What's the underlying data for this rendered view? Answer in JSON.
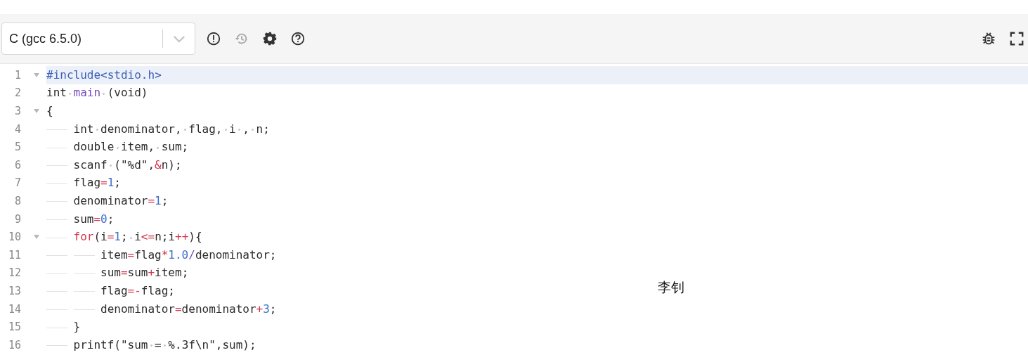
{
  "toolbar": {
    "language_select": {
      "value": "C (gcc 6.5.0)"
    },
    "left_buttons": [
      {
        "kind": "info",
        "disabled": false
      },
      {
        "kind": "history",
        "disabled": true
      },
      {
        "kind": "settings",
        "disabled": false
      },
      {
        "kind": "help",
        "disabled": false
      }
    ],
    "right_buttons": [
      {
        "kind": "debug",
        "disabled": false
      },
      {
        "kind": "fullscreen",
        "disabled": false
      }
    ]
  },
  "editor": {
    "lines": [
      {
        "number": "1",
        "foldable": true,
        "active": true,
        "tokens": [
          {
            "text": "#include<stdio.h>",
            "kind": "meta"
          }
        ]
      },
      {
        "number": "2",
        "foldable": false,
        "active": false,
        "tokens": [
          {
            "text": "int ",
            "kind": "plain"
          },
          {
            "text": "main",
            "kind": "function"
          },
          {
            "text": " (void)",
            "kind": "plain"
          }
        ]
      },
      {
        "number": "3",
        "foldable": true,
        "active": false,
        "tokens": [
          {
            "text": "{",
            "kind": "plain"
          }
        ]
      },
      {
        "number": "4",
        "foldable": false,
        "active": false,
        "tokens": [
          {
            "text": "\tint denominator, flag, i , n;",
            "kind": "plain"
          }
        ]
      },
      {
        "number": "5",
        "foldable": false,
        "active": false,
        "tokens": [
          {
            "text": "\tdouble item, sum;",
            "kind": "plain"
          }
        ]
      },
      {
        "number": "6",
        "foldable": false,
        "active": false,
        "tokens": [
          {
            "text": "\tscanf (\"%d\",",
            "kind": "plain"
          },
          {
            "text": "&",
            "kind": "operator"
          },
          {
            "text": "n);",
            "kind": "plain"
          }
        ]
      },
      {
        "number": "7",
        "foldable": false,
        "active": false,
        "tokens": [
          {
            "text": "\tflag",
            "kind": "plain"
          },
          {
            "text": "=",
            "kind": "operator"
          },
          {
            "text": "1",
            "kind": "number"
          },
          {
            "text": ";",
            "kind": "plain"
          }
        ]
      },
      {
        "number": "8",
        "foldable": false,
        "active": false,
        "tokens": [
          {
            "text": "\tdenominator",
            "kind": "plain"
          },
          {
            "text": "=",
            "kind": "operator"
          },
          {
            "text": "1",
            "kind": "number"
          },
          {
            "text": ";",
            "kind": "plain"
          }
        ]
      },
      {
        "number": "9",
        "foldable": false,
        "active": false,
        "tokens": [
          {
            "text": "\tsum",
            "kind": "plain"
          },
          {
            "text": "=",
            "kind": "operator"
          },
          {
            "text": "0",
            "kind": "number"
          },
          {
            "text": ";",
            "kind": "plain"
          }
        ]
      },
      {
        "number": "10",
        "foldable": true,
        "active": false,
        "tokens": [
          {
            "text": "\tfor",
            "kind": "keyword"
          },
          {
            "text": "(i",
            "kind": "plain"
          },
          {
            "text": "=",
            "kind": "operator"
          },
          {
            "text": "1",
            "kind": "number"
          },
          {
            "text": "; i",
            "kind": "plain"
          },
          {
            "text": "<=",
            "kind": "operator"
          },
          {
            "text": "n;i",
            "kind": "plain"
          },
          {
            "text": "++",
            "kind": "operator"
          },
          {
            "text": "){",
            "kind": "plain"
          }
        ]
      },
      {
        "number": "11",
        "foldable": false,
        "active": false,
        "tokens": [
          {
            "text": "\t\titem",
            "kind": "plain"
          },
          {
            "text": "=",
            "kind": "operator"
          },
          {
            "text": "flag",
            "kind": "plain"
          },
          {
            "text": "*",
            "kind": "operator"
          },
          {
            "text": "1.0",
            "kind": "number"
          },
          {
            "text": "/",
            "kind": "function"
          },
          {
            "text": "denominator;",
            "kind": "plain"
          }
        ]
      },
      {
        "number": "12",
        "foldable": false,
        "active": false,
        "tokens": [
          {
            "text": "\t\tsum",
            "kind": "plain"
          },
          {
            "text": "=",
            "kind": "operator"
          },
          {
            "text": "sum",
            "kind": "plain"
          },
          {
            "text": "+",
            "kind": "operator"
          },
          {
            "text": "item;",
            "kind": "plain"
          }
        ]
      },
      {
        "number": "13",
        "foldable": false,
        "active": false,
        "tokens": [
          {
            "text": "\t\tflag",
            "kind": "plain"
          },
          {
            "text": "=-",
            "kind": "operator"
          },
          {
            "text": "flag;",
            "kind": "plain"
          }
        ]
      },
      {
        "number": "14",
        "foldable": false,
        "active": false,
        "tokens": [
          {
            "text": "\t\tdenominator",
            "kind": "plain"
          },
          {
            "text": "=",
            "kind": "operator"
          },
          {
            "text": "denominator",
            "kind": "plain"
          },
          {
            "text": "+",
            "kind": "operator"
          },
          {
            "text": "3",
            "kind": "number"
          },
          {
            "text": ";",
            "kind": "plain"
          }
        ]
      },
      {
        "number": "15",
        "foldable": false,
        "active": false,
        "tokens": [
          {
            "text": "\t}",
            "kind": "plain"
          }
        ]
      },
      {
        "number": "16",
        "foldable": false,
        "active": false,
        "tokens": [
          {
            "text": "\tprintf(\"sum = %.3f\\n\",sum);",
            "kind": "plain"
          }
        ]
      }
    ]
  },
  "overlay_note": "李钊"
}
